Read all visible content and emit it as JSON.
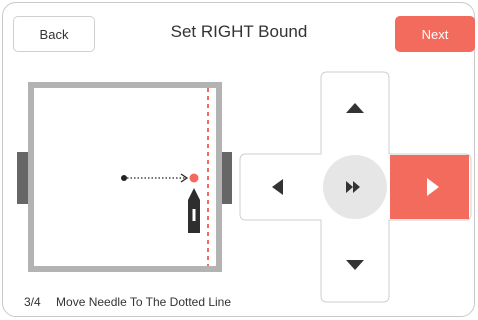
{
  "header": {
    "back_label": "Back",
    "title": "Set RIGHT Bound",
    "next_label": "Next"
  },
  "footer": {
    "step_number": "3/4",
    "instruction": "Move Needle To The Dotted Line"
  },
  "colors": {
    "accent": "#f26b5c",
    "bed_border": "#b3b3b3",
    "dpad_center": "#e6e6e6",
    "icon": "#333333"
  },
  "dpad": {
    "active_direction": "right",
    "icons": [
      "arrow-up-icon",
      "arrow-left-icon",
      "fast-forward-icon",
      "arrow-right-icon",
      "arrow-down-icon"
    ]
  }
}
